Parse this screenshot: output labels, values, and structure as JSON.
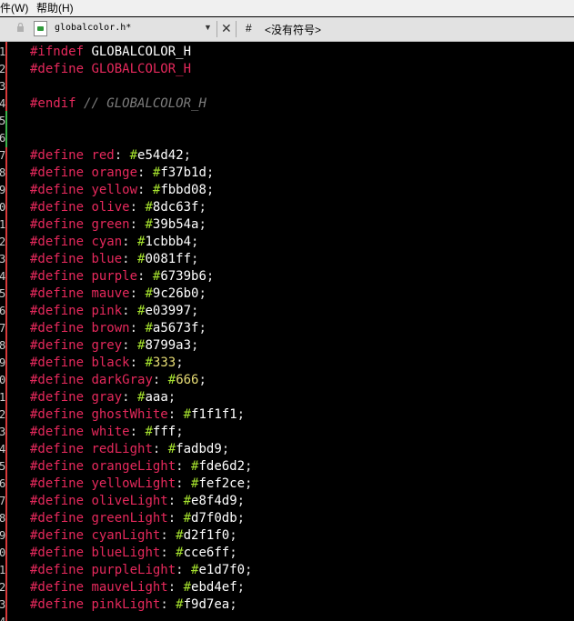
{
  "menubar": {
    "items": [
      "件(W)",
      "帮助(H)"
    ]
  },
  "tab": {
    "filename": "globalcolor.h*",
    "dropdown": "▼",
    "close": "✕",
    "hash": "#",
    "symbol": "<没有符号>"
  },
  "gutter_numbers": [
    "1",
    "2",
    "3",
    "4",
    "5",
    "6",
    "7",
    "8",
    "9",
    "0",
    "1",
    "2",
    "3",
    "4",
    "5",
    "6",
    "7",
    "8",
    "9",
    "0",
    "1",
    "2",
    "3",
    "4",
    "5",
    "6",
    "7",
    "8",
    "9",
    "0",
    "1",
    "2",
    "3",
    "4"
  ],
  "code": {
    "ifndef_kw": "#ifndef",
    "guard": "GLOBALCOLOR_H",
    "define_kw": "#define",
    "guard2": "GLOBALCOLOR_H",
    "endif_kw": "#endif",
    "endif_comment": "// GLOBALCOLOR_H",
    "defines": [
      {
        "name": "red",
        "hex": "e54d42"
      },
      {
        "name": "orange",
        "hex": "f37b1d"
      },
      {
        "name": "yellow",
        "hex": "fbbd08"
      },
      {
        "name": "olive",
        "hex": "8dc63f"
      },
      {
        "name": "green",
        "hex": "39b54a"
      },
      {
        "name": "cyan",
        "hex": "1cbbb4"
      },
      {
        "name": "blue",
        "hex": "0081ff"
      },
      {
        "name": "purple",
        "hex": "6739b6"
      },
      {
        "name": "mauve",
        "hex": "9c26b0"
      },
      {
        "name": "pink",
        "hex": "e03997"
      },
      {
        "name": "brown",
        "hex": "a5673f"
      },
      {
        "name": "grey",
        "hex": "8799a3"
      },
      {
        "name": "black",
        "hex": "333"
      },
      {
        "name": "darkGray",
        "hex": "666"
      },
      {
        "name": "gray",
        "hex": "aaa"
      },
      {
        "name": "ghostWhite",
        "hex": "f1f1f1"
      },
      {
        "name": "white",
        "hex": "fff"
      },
      {
        "name": "redLight",
        "hex": "fadbd9"
      },
      {
        "name": "orangeLight",
        "hex": "fde6d2"
      },
      {
        "name": "yellowLight",
        "hex": "fef2ce"
      },
      {
        "name": "oliveLight",
        "hex": "e8f4d9"
      },
      {
        "name": "greenLight",
        "hex": "d7f0db"
      },
      {
        "name": "cyanLight",
        "hex": "d2f1f0"
      },
      {
        "name": "blueLight",
        "hex": "cce6ff"
      },
      {
        "name": "purpleLight",
        "hex": "e1d7f0"
      },
      {
        "name": "mauveLight",
        "hex": "ebd4ef"
      },
      {
        "name": "pinkLight",
        "hex": "f9d7ea"
      }
    ]
  },
  "colors": {
    "keyword": "#e6295c",
    "hash_sign": "#a6e22e",
    "number": "#e6db74",
    "comment": "#7d7d7d",
    "background": "#000000"
  }
}
